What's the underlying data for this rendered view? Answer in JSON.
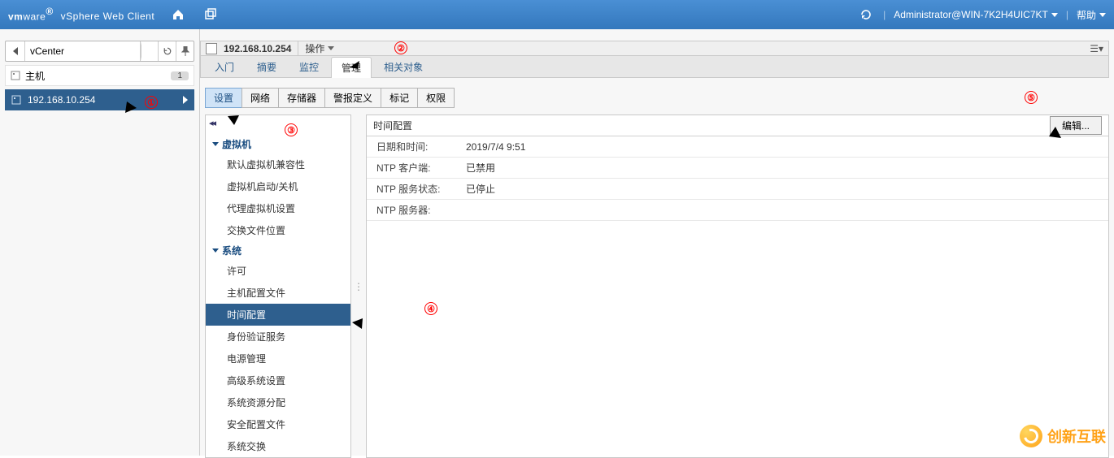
{
  "banner": {
    "brand_vm": "vm",
    "brand_ware": "ware",
    "brand_reg": "®",
    "brand_client": "vSphere Web Client",
    "user": "Administrator@WIN-7K2H4UIC7KT",
    "help": "帮助"
  },
  "left": {
    "crumb": "vCenter",
    "host_label": "主机",
    "host_badge": "1",
    "host_ip": "192.168.10.254"
  },
  "obj": {
    "ip": "192.168.10.254",
    "actions": "操作"
  },
  "toptabs": {
    "t0": "入门",
    "t1": "摘要",
    "t2": "监控",
    "t3": "管理",
    "t4": "相关对象"
  },
  "subtabs": {
    "s0": "设置",
    "s1": "网络",
    "s2": "存储器",
    "s3": "警报定义",
    "s4": "标记",
    "s5": "权限"
  },
  "nav": {
    "g0": "虚拟机",
    "g0_items": {
      "i0": "默认虚拟机兼容性",
      "i1": "虚拟机启动/关机",
      "i2": "代理虚拟机设置",
      "i3": "交换文件位置"
    },
    "g1": "系统",
    "g1_items": {
      "i0": "许可",
      "i1": "主机配置文件",
      "i2": "时间配置",
      "i3": "身份验证服务",
      "i4": "电源管理",
      "i5": "高级系统设置",
      "i6": "系统资源分配",
      "i7": "安全配置文件",
      "i8": "系统交换"
    }
  },
  "detail": {
    "title": "时间配置",
    "edit": "编辑...",
    "rows": {
      "r0k": "日期和时间:",
      "r0v": "2019/7/4 9:51",
      "r1k": "NTP 客户端:",
      "r1v": "已禁用",
      "r2k": "NTP 服务状态:",
      "r2v": "已停止",
      "r3k": "NTP 服务器:",
      "r3v": ""
    }
  },
  "ann": {
    "n1": "①",
    "n2": "②",
    "n3": "③",
    "n4": "④",
    "n5": "⑤"
  },
  "wm": "创新互联"
}
